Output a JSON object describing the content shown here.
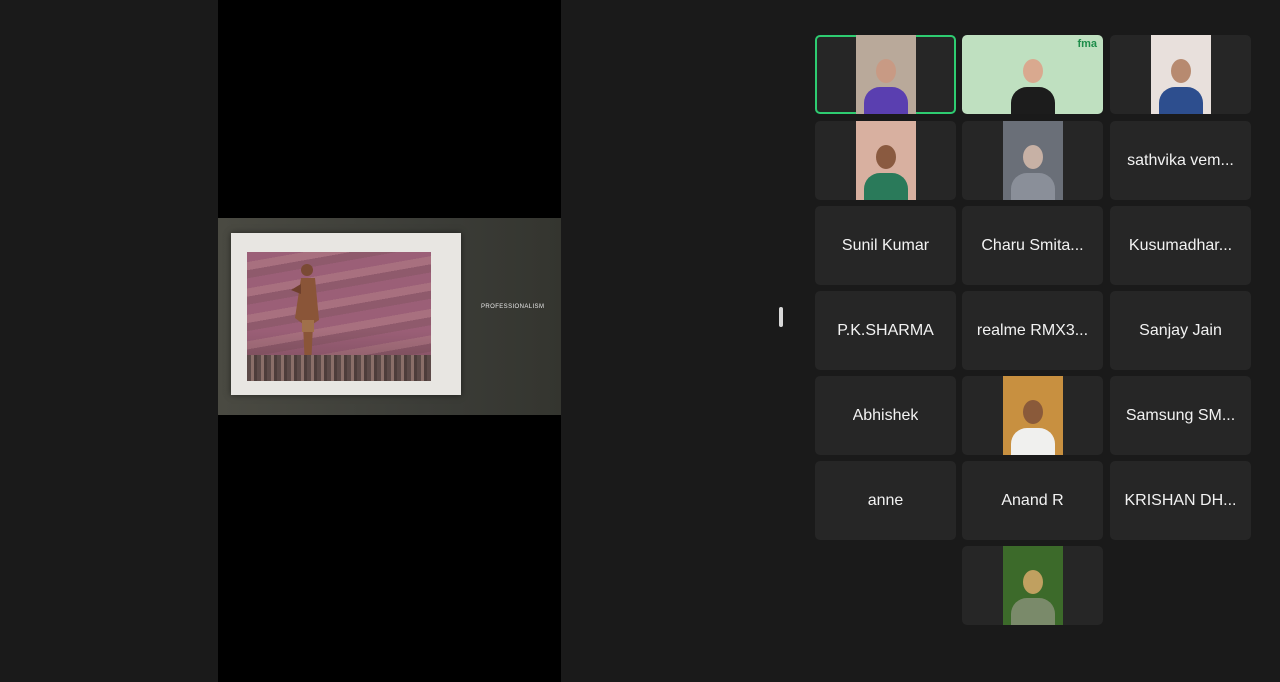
{
  "share": {
    "slide_caption": "PROFESSIONALISM"
  },
  "participants": [
    {
      "id": "p1",
      "name": "",
      "video": true,
      "active": true
    },
    {
      "id": "p2",
      "name": "",
      "video": true,
      "brand": "fma"
    },
    {
      "id": "p3",
      "name": "",
      "video": true
    },
    {
      "id": "p4",
      "name": "",
      "video": true
    },
    {
      "id": "p5",
      "name": "",
      "video": true
    },
    {
      "id": "p6",
      "name": "sathvika vem..."
    },
    {
      "id": "p7",
      "name": "Sunil Kumar"
    },
    {
      "id": "p8",
      "name": "Charu Smita..."
    },
    {
      "id": "p9",
      "name": "Kusumadhar..."
    },
    {
      "id": "p10",
      "name": "P.K.SHARMA"
    },
    {
      "id": "p11",
      "name": "realme RMX3..."
    },
    {
      "id": "p12",
      "name": "Sanjay Jain"
    },
    {
      "id": "p13",
      "name": "Abhishek"
    },
    {
      "id": "p14",
      "name": "",
      "video": true
    },
    {
      "id": "p15",
      "name": "Samsung SM..."
    },
    {
      "id": "p16",
      "name": "anne"
    },
    {
      "id": "p17",
      "name": "Anand R"
    },
    {
      "id": "p18",
      "name": "KRISHAN DH..."
    },
    {
      "id": "p19",
      "name": "",
      "video": true
    }
  ],
  "colors": {
    "active_speaker": "#2ecc71",
    "tile_bg": "#262626",
    "app_bg": "#1a1a1a"
  }
}
